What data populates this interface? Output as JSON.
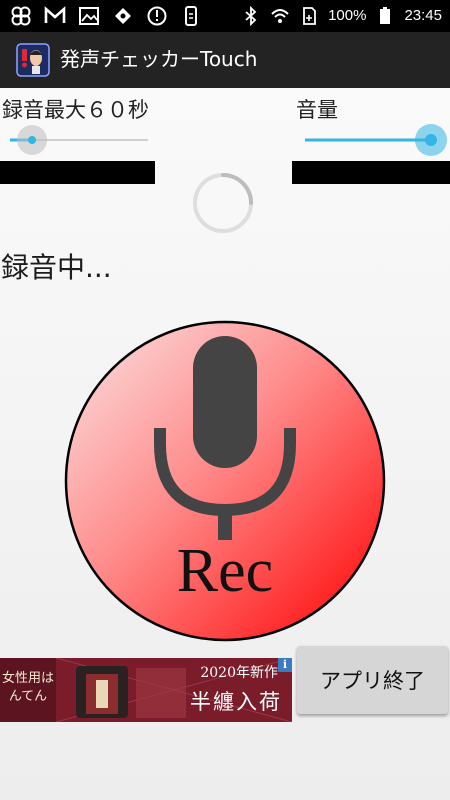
{
  "status_bar": {
    "icons": [
      "pinwheel-icon",
      "gmail-icon",
      "gallery-icon",
      "puzzle-icon",
      "alert-icon",
      "phone-sync-icon",
      "bluetooth-icon",
      "wifi-icon",
      "battery-icon"
    ],
    "battery_percent": "100%",
    "time": "23:45"
  },
  "app_bar": {
    "title": "発声チェッカーTouch",
    "icon": "app-icon"
  },
  "controls": {
    "max_rec_label": "録音最大６０秒",
    "max_rec_slider_value": 0.16,
    "volume_label": "音量",
    "volume_slider_value": 1.0
  },
  "status": {
    "text": "録音中..."
  },
  "rec_button": {
    "label": "Rec",
    "icon": "microphone-icon",
    "gradient_start": "#fbe3e3",
    "gradient_end": "#ff0000"
  },
  "ad": {
    "left_text": "女性用はんてん",
    "year_text": "2020年新作",
    "main_text": "半纏入荷",
    "info_label": "i"
  },
  "exit_button": {
    "label": "アプリ終了"
  },
  "colors": {
    "accent": "#33b5e5",
    "status_bar": "#000000",
    "app_bar": "#232323"
  }
}
